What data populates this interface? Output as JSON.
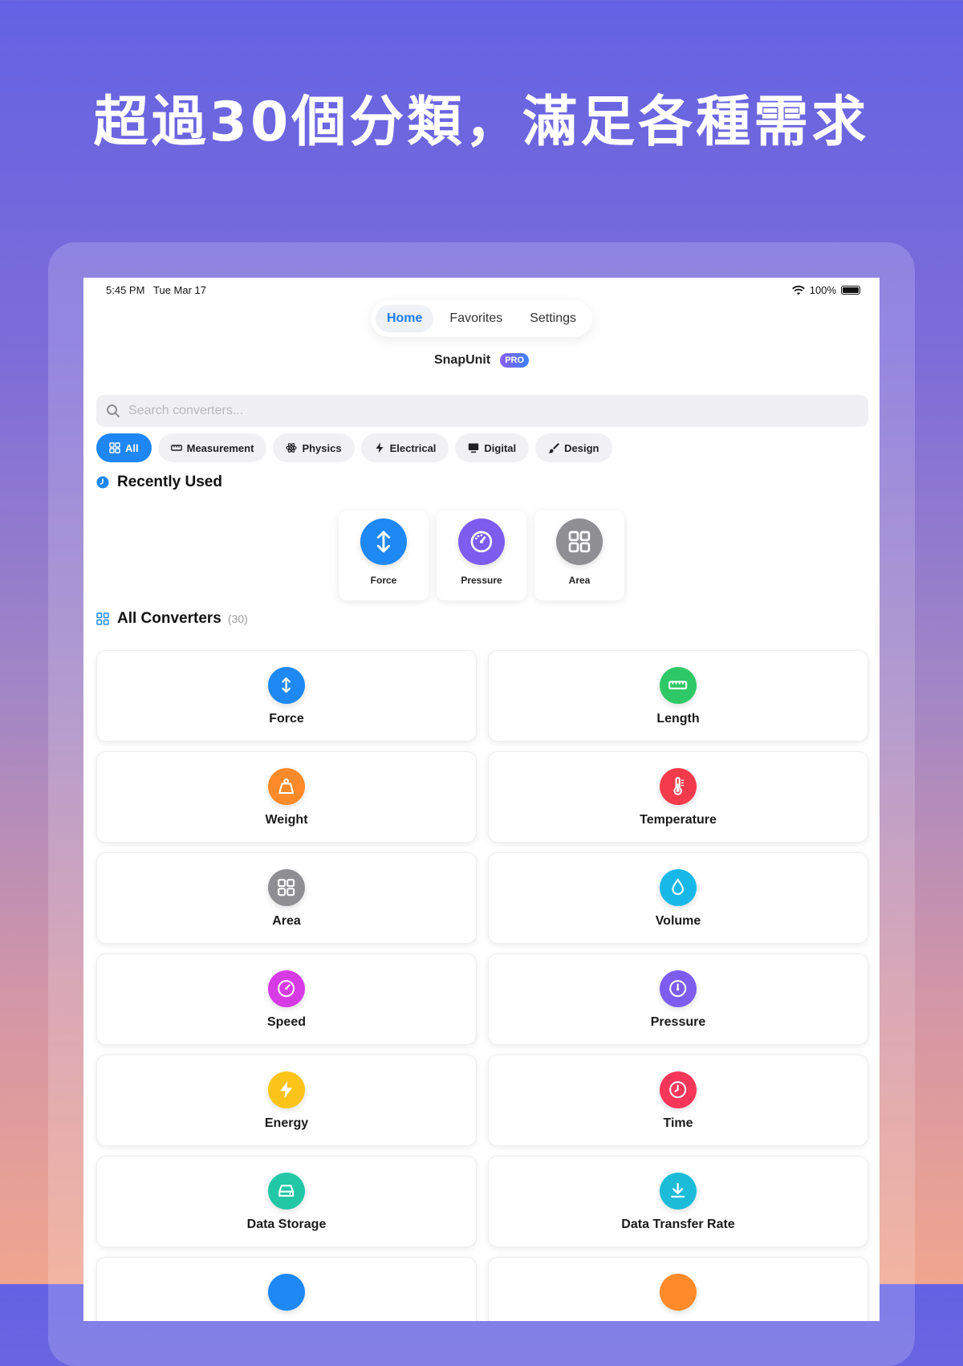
{
  "headline": "超過30個分類，滿足各種需求",
  "status": {
    "time": "5:45 PM",
    "date": "Tue Mar 17",
    "battery": "100%"
  },
  "tabs": [
    {
      "label": "Home",
      "active": true
    },
    {
      "label": "Favorites",
      "active": false
    },
    {
      "label": "Settings",
      "active": false
    }
  ],
  "app": {
    "name": "SnapUnit",
    "badge": "PRO"
  },
  "search": {
    "placeholder": "Search converters..."
  },
  "chips": [
    {
      "label": "All",
      "icon": "grid-icon",
      "active": true
    },
    {
      "label": "Measurement",
      "icon": "ruler-icon",
      "active": false
    },
    {
      "label": "Physics",
      "icon": "atom-icon",
      "active": false
    },
    {
      "label": "Electrical",
      "icon": "bolt-icon",
      "active": false
    },
    {
      "label": "Digital",
      "icon": "monitor-icon",
      "active": false
    },
    {
      "label": "Design",
      "icon": "brush-icon",
      "active": false
    }
  ],
  "recent": {
    "title": "Recently Used",
    "items": [
      {
        "label": "Force",
        "icon": "arrows-vertical-icon",
        "color": "#1e88f5"
      },
      {
        "label": "Pressure",
        "icon": "gauge-icon",
        "color": "#7d5cf0"
      },
      {
        "label": "Area",
        "icon": "grid-icon",
        "color": "#8e8e93"
      }
    ]
  },
  "all": {
    "title": "All Converters",
    "count": "(30)",
    "items": [
      {
        "label": "Force",
        "icon": "arrows-vertical-icon",
        "color": "#1e88f5"
      },
      {
        "label": "Length",
        "icon": "ruler-icon",
        "color": "#2fc866"
      },
      {
        "label": "Weight",
        "icon": "scale-weight-icon",
        "color": "#ff8a2a"
      },
      {
        "label": "Temperature",
        "icon": "thermometer-icon",
        "color": "#f43b4b"
      },
      {
        "label": "Area",
        "icon": "grid-icon",
        "color": "#8e8e93"
      },
      {
        "label": "Volume",
        "icon": "drop-icon",
        "color": "#18b8e8"
      },
      {
        "label": "Speed",
        "icon": "speedometer-icon",
        "color": "#d63be6"
      },
      {
        "label": "Pressure",
        "icon": "gauge-icon",
        "color": "#7d5cf0"
      },
      {
        "label": "Energy",
        "icon": "bolt-icon",
        "color": "#fcc419"
      },
      {
        "label": "Time",
        "icon": "clock-icon",
        "color": "#f7365a"
      },
      {
        "label": "Data Storage",
        "icon": "hard-drive-icon",
        "color": "#22c7a6"
      },
      {
        "label": "Data Transfer Rate",
        "icon": "download-icon",
        "color": "#1cbcd8"
      },
      {
        "label": "",
        "icon": "partial-icon",
        "color": "#1e88f5"
      },
      {
        "label": "",
        "icon": "partial-icon",
        "color": "#ff8a2a"
      }
    ]
  }
}
